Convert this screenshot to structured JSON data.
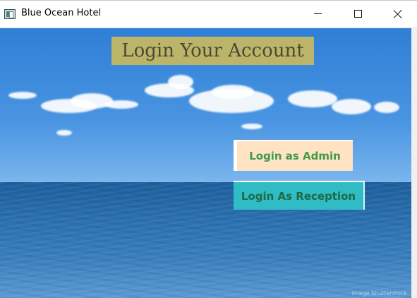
{
  "window": {
    "title": "Blue Ocean Hotel",
    "icon": "app-window-icon",
    "controls": {
      "minimize": "minimize-icon",
      "maximize": "maximize-icon",
      "close": "close-icon"
    }
  },
  "main": {
    "heading": "Login Your Account",
    "admin_button_label": "Login as Admin",
    "reception_button_label": "Login As Reception",
    "watermark": "image Shutterstock"
  },
  "colors": {
    "heading_bg": "#bcb469",
    "admin_button_bg": "#ffe3c3",
    "admin_button_text": "#3f9a4a",
    "reception_button_bg": "#2fbcc4",
    "reception_button_text": "#1f6a44"
  }
}
